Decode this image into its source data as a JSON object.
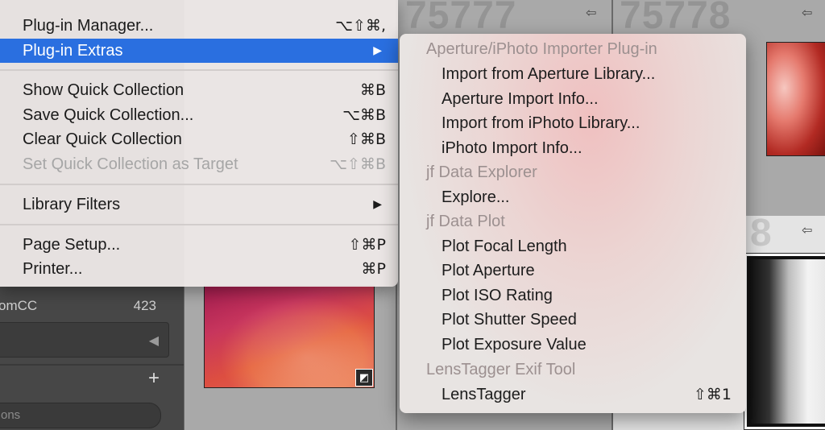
{
  "background": {
    "collection_label": "omCC",
    "collection_count": "423",
    "search_placeholder": "ons",
    "plus_label": "+",
    "cell_numbers": [
      "75777",
      "75778",
      "8"
    ]
  },
  "menu": {
    "items": [
      {
        "label": "Plug-in Manager...",
        "shortcut": "⌥⇧⌘,"
      },
      {
        "label": "Plug-in Extras",
        "shortcut": "",
        "submenu_arrow": "▶"
      },
      {
        "label": "Show Quick Collection",
        "shortcut": "⌘B"
      },
      {
        "label": "Save Quick Collection...",
        "shortcut": "⌥⌘B"
      },
      {
        "label": "Clear Quick Collection",
        "shortcut": "⇧⌘B"
      },
      {
        "label": "Set Quick Collection as Target",
        "shortcut": "⌥⇧⌘B"
      },
      {
        "label": "Library Filters",
        "shortcut": "",
        "submenu_arrow": "▶"
      },
      {
        "label": "Page Setup...",
        "shortcut": "⇧⌘P"
      },
      {
        "label": "Printer...",
        "shortcut": "⌘P"
      }
    ]
  },
  "submenu": {
    "items": [
      {
        "label": "Aperture/iPhoto Importer Plug-in"
      },
      {
        "label": "Import from Aperture Library..."
      },
      {
        "label": "Aperture Import Info..."
      },
      {
        "label": "Import from iPhoto Library..."
      },
      {
        "label": "iPhoto Import Info..."
      },
      {
        "label": "jf Data Explorer"
      },
      {
        "label": "Explore..."
      },
      {
        "label": "jf Data Plot"
      },
      {
        "label": "Plot Focal Length"
      },
      {
        "label": "Plot Aperture"
      },
      {
        "label": "Plot ISO Rating"
      },
      {
        "label": "Plot Shutter Speed"
      },
      {
        "label": "Plot Exposure Value"
      },
      {
        "label": "LensTagger Exif Tool"
      },
      {
        "label": "LensTagger",
        "shortcut": "⇧⌘1"
      }
    ]
  },
  "colors": {
    "selection": "#2a6fe0",
    "disabled_text": "#a6a6a6",
    "section_header_text": "#9c9090"
  },
  "icons": {
    "submenu_arrow": "▶",
    "rotate": "⇦",
    "left_collapse": "◀",
    "badge": "◩"
  }
}
